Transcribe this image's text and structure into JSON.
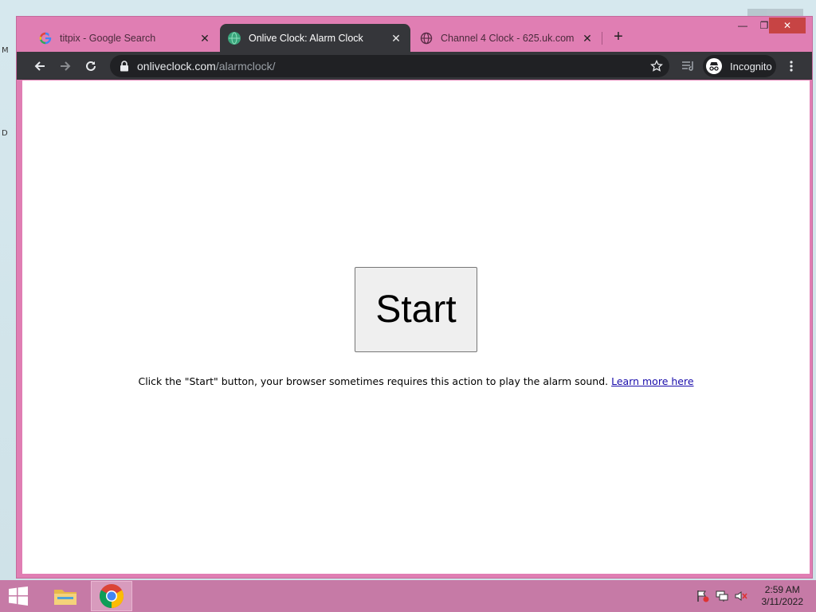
{
  "desktop": {
    "frag_top": "M",
    "frag_mid": "D"
  },
  "tabs": [
    {
      "label": "titpix - Google Search",
      "favicon": "google-g-icon",
      "active": false
    },
    {
      "label": "Onlive Clock: Alarm Clock",
      "favicon": "onliveclock-globe-icon",
      "active": true
    },
    {
      "label": "Channel 4 Clock - 625.uk.com",
      "favicon": "globe-icon",
      "active": false
    }
  ],
  "window_controls": {
    "minimize": "—",
    "maximize": "❐",
    "close": "✕"
  },
  "newtab": "+",
  "toolbar": {
    "url_host": "onliveclock.com",
    "url_path": "/alarmclock/",
    "incognito_label": "Incognito"
  },
  "page": {
    "start_label": "Start",
    "hint_text": "Click the \"Start\" button, your browser sometimes requires this action to play the alarm sound.",
    "learn_more": "Learn more here"
  },
  "taskbar": {
    "time": "2:59 AM",
    "date": "3/11/2022"
  },
  "colors": {
    "window_frame": "#e07eb3",
    "toolbar": "#35363a",
    "taskbar": "#c67aa6",
    "link": "#1a0dab"
  }
}
